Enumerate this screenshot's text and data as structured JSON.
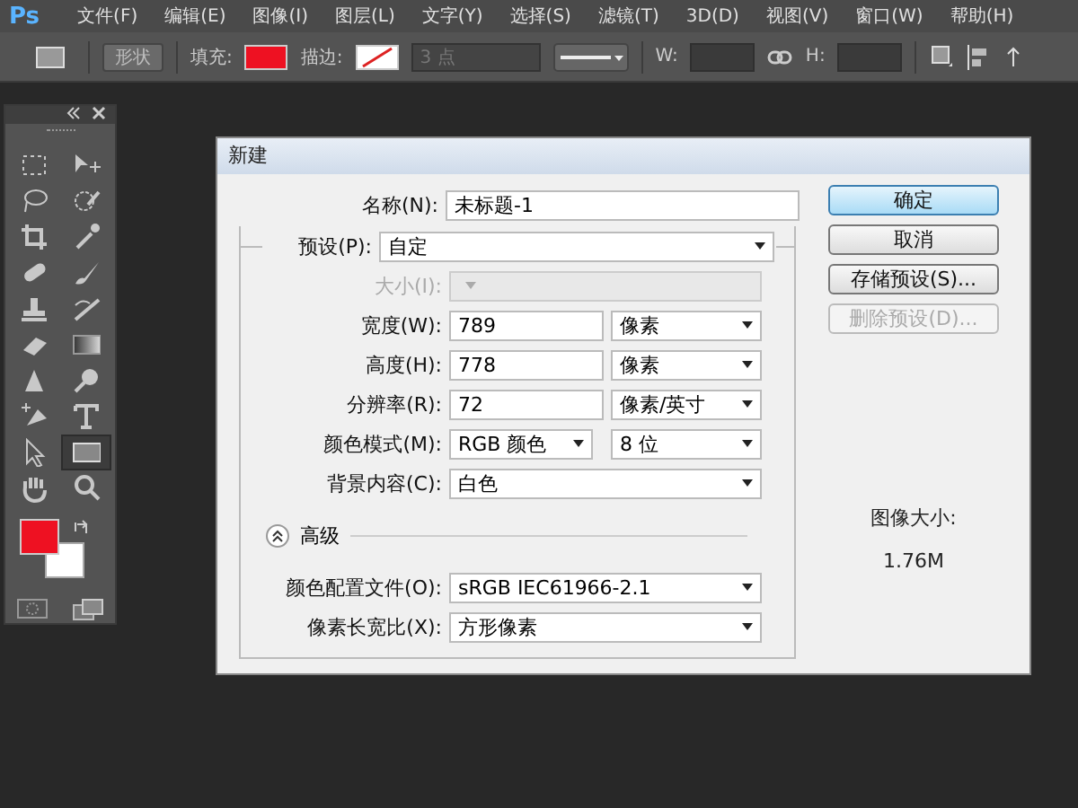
{
  "menu_bar": {
    "logo": "Ps",
    "items": [
      "文件(F)",
      "编辑(E)",
      "图像(I)",
      "图层(L)",
      "文字(Y)",
      "选择(S)",
      "滤镜(T)",
      "3D(D)",
      "视图(V)",
      "窗口(W)",
      "帮助(H)"
    ]
  },
  "options_bar": {
    "mode": "形状",
    "fill_label": "填充:",
    "stroke_label": "描边:",
    "stroke_width": "3 点",
    "w_label": "W:",
    "h_label": "H:"
  },
  "toolbox": {
    "tools": [
      {
        "kind": "marquee",
        "selected": false
      },
      {
        "kind": "move",
        "selected": false
      },
      {
        "kind": "lasso",
        "selected": false
      },
      {
        "kind": "quick-select",
        "selected": false
      },
      {
        "kind": "crop",
        "selected": false
      },
      {
        "kind": "eyedropper",
        "selected": false
      },
      {
        "kind": "bandage",
        "selected": false
      },
      {
        "kind": "brush",
        "selected": false
      },
      {
        "kind": "stamp",
        "selected": false
      },
      {
        "kind": "history-brush",
        "selected": false
      },
      {
        "kind": "eraser",
        "selected": false
      },
      {
        "kind": "gradient",
        "selected": false
      },
      {
        "kind": "blur",
        "selected": false
      },
      {
        "kind": "dodge",
        "selected": false
      },
      {
        "kind": "pen",
        "selected": false
      },
      {
        "kind": "type",
        "selected": false
      },
      {
        "kind": "path-select",
        "selected": false
      },
      {
        "kind": "rectangle",
        "selected": true
      },
      {
        "kind": "hand",
        "selected": false
      },
      {
        "kind": "zoom",
        "selected": false
      }
    ]
  },
  "dialog": {
    "title": "新建",
    "name": {
      "label": "名称(N):",
      "value": "未标题-1"
    },
    "preset": {
      "label": "预设(P):",
      "value": "自定"
    },
    "rows": [
      {
        "kind": "select",
        "label": "大小(I):",
        "value": "",
        "disabled": true
      },
      {
        "kind": "input_select",
        "label": "宽度(W):",
        "value": "789",
        "unit": "像素",
        "disabled": false
      },
      {
        "kind": "input_select",
        "label": "高度(H):",
        "value": "778",
        "unit": "像素",
        "disabled": false
      },
      {
        "kind": "input_select",
        "label": "分辨率(R):",
        "value": "72",
        "unit": "像素/英寸",
        "disabled": false
      },
      {
        "kind": "two_select",
        "label": "颜色模式(M):",
        "value": "RGB 颜色",
        "unit": "8 位",
        "disabled": false
      },
      {
        "kind": "select",
        "label": "背景内容(C):",
        "value": "白色",
        "disabled": false
      }
    ],
    "advanced": {
      "label": "高级",
      "expanded": true
    },
    "advanced_rows": [
      {
        "kind": "select",
        "label": "颜色配置文件(O):",
        "value": "sRGB IEC61966-2.1",
        "disabled": false
      },
      {
        "kind": "select",
        "label": "像素长宽比(X):",
        "value": "方形像素",
        "disabled": false
      }
    ],
    "buttons": [
      {
        "label": "确定",
        "default": true,
        "disabled": false
      },
      {
        "label": "取消",
        "default": false,
        "disabled": false
      },
      {
        "label": "存储预设(S)...",
        "default": false,
        "disabled": false
      },
      {
        "label": "删除预设(D)...",
        "default": false,
        "disabled": true
      }
    ],
    "image_size_label": "图像大小:",
    "image_size_value": "1.76M"
  }
}
